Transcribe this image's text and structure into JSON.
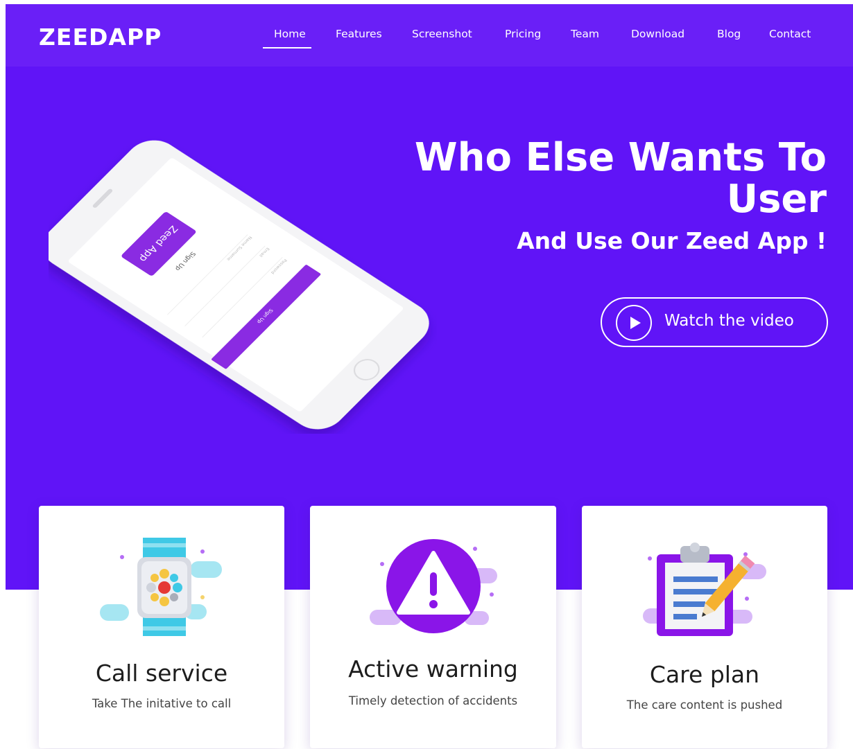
{
  "header": {
    "logo": "ZEEDAPP",
    "nav": [
      {
        "label": "Home",
        "active": true
      },
      {
        "label": "Features"
      },
      {
        "label": "Screenshot"
      },
      {
        "label": "Pricing"
      },
      {
        "label": "Team"
      },
      {
        "label": "Download"
      },
      {
        "label": "Blog"
      },
      {
        "label": "Contact"
      }
    ]
  },
  "hero": {
    "title_line1": "Who Else Wants To",
    "title_line2": "User",
    "subtitle": "And Use Our Zeed App !",
    "video_button": "Watch the video",
    "phone": {
      "app_badge": "Zeed App",
      "heading": "Sign Up",
      "field_name": "Name Surname",
      "field_email": "Email",
      "field_password": "Password",
      "button": "Sign Up"
    }
  },
  "features": [
    {
      "title": "Call service",
      "desc": "Take The initative to call",
      "icon": "smartwatch-icon"
    },
    {
      "title": "Active warning",
      "desc": "Timely detection of accidents",
      "icon": "warning-icon"
    },
    {
      "title": "Care plan",
      "desc": "The care content is pushed",
      "icon": "clipboard-pencil-icon"
    }
  ],
  "colors": {
    "brand_purple": "#6014f7",
    "nav_purple": "#6a1ff7",
    "accent_violet": "#8a2be2",
    "white": "#ffffff"
  }
}
